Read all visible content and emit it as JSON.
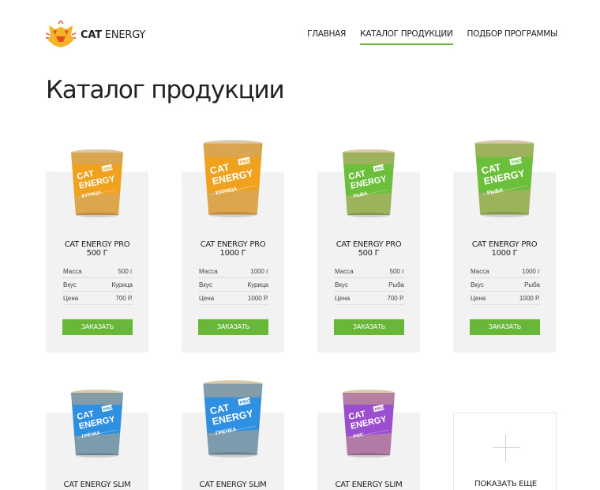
{
  "brand": {
    "name_bold": "CAT",
    "name_rest": "ENERGY"
  },
  "nav": [
    {
      "label": "ГЛАВНАЯ",
      "active": false
    },
    {
      "label": "КАТАЛОГ ПРОДУКЦИИ",
      "active": true
    },
    {
      "label": "ПОДБОР ПРОГРАММЫ",
      "active": false
    }
  ],
  "page_title": "Каталог продукции",
  "spec_labels": {
    "mass": "Масса",
    "taste": "Вкус",
    "price": "Цена"
  },
  "order_label": "ЗАКАЗАТЬ",
  "products": [
    {
      "title1": "CAT ENERGY PRO",
      "title2": "500 Г",
      "mass": "500 г",
      "taste": "Курица",
      "price": "700 Р.",
      "pack_color": "#f0a21e",
      "pack_label": "КУРИЦА",
      "badge": "PRO"
    },
    {
      "title1": "CAT ENERGY PRO",
      "title2": "1000 Г",
      "mass": "1000 г",
      "taste": "Курица",
      "price": "1000 Р.",
      "pack_color": "#f0a21e",
      "pack_label": "КУРИЦА",
      "badge": "PRO"
    },
    {
      "title1": "CAT ENERGY PRO",
      "title2": "500 Г",
      "mass": "500 г",
      "taste": "Рыба",
      "price": "700 Р.",
      "pack_color": "#6cbf3a",
      "pack_label": "РЫБА",
      "badge": "PRO"
    },
    {
      "title1": "CAT ENERGY PRO",
      "title2": "1000 Г",
      "mass": "1000 г",
      "taste": "Рыба",
      "price": "1000 Р.",
      "pack_color": "#6cbf3a",
      "pack_label": "РЫБА",
      "badge": "PRO"
    },
    {
      "title1": "CAT ENERGY SLIM",
      "pack_color": "#2f8fe0",
      "pack_label": "ГРЕЧКА",
      "badge": "PRO"
    },
    {
      "title1": "CAT ENERGY SLIM",
      "pack_color": "#2f8fe0",
      "pack_label": "ГРЕЧКА",
      "badge": "PRO"
    },
    {
      "title1": "CAT ENERGY SLIM",
      "pack_color": "#9b4fd0",
      "pack_label": "РИС",
      "badge": "PRO"
    }
  ],
  "show_more_label": "ПОКАЗАТЬ ЕЩЕ",
  "colors": {
    "accent": "#68b738",
    "card_bg": "#f2f2f2",
    "text": "#222222"
  }
}
